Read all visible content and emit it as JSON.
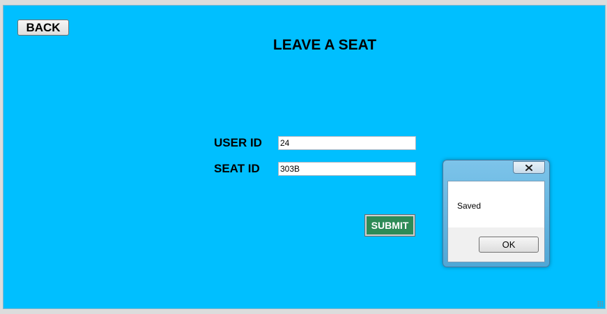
{
  "form": {
    "back_label": "BACK",
    "title": "LEAVE A SEAT",
    "user_id_label": "USER ID",
    "user_id_value": "24",
    "seat_id_label": "SEAT ID",
    "seat_id_value": "303B",
    "submit_label": "SUBMIT"
  },
  "dialog": {
    "message": "Saved",
    "ok_label": "OK",
    "close_icon": "close-icon"
  },
  "colors": {
    "form_background": "#00bfff",
    "submit_background": "#2e8b57"
  }
}
